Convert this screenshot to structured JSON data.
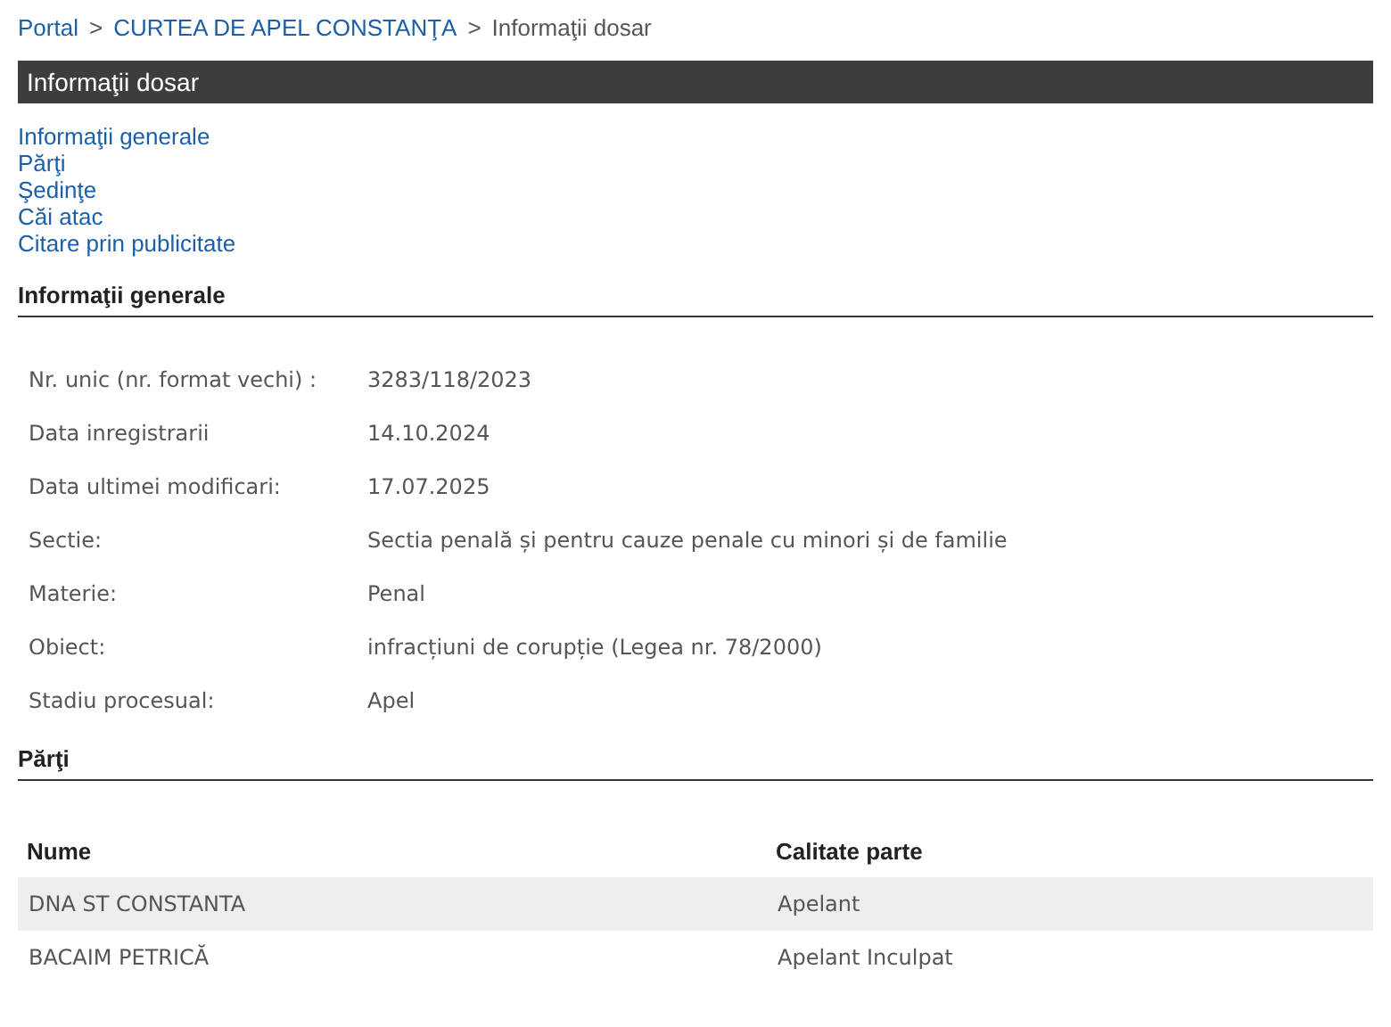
{
  "breadcrumb": [
    {
      "label": "Portal",
      "link": true
    },
    {
      "label": "CURTEA DE APEL CONSTANŢA",
      "link": true
    },
    {
      "label": "Informaţii dosar",
      "link": false
    }
  ],
  "separator": ">",
  "header_bar": {
    "title": "Informaţii dosar"
  },
  "nav_links": [
    "Informaţii generale",
    "Părţi",
    "Şedinţe",
    "Căi atac",
    "Citare prin publicitate"
  ],
  "general_info": {
    "title": "Informaţii generale",
    "fields": [
      {
        "label": "Nr. unic (nr. format vechi) :",
        "value": "3283/118/2023"
      },
      {
        "label": "Data inregistrarii",
        "value": "14.10.2024"
      },
      {
        "label": "Data ultimei modificari:",
        "value": "17.07.2025"
      },
      {
        "label": "Sectie:",
        "value": "Sectia penală și pentru cauze penale cu minori și de familie"
      },
      {
        "label": "Materie:",
        "value": "Penal"
      },
      {
        "label": "Obiect:",
        "value": "infracțiuni de corupție (Legea nr. 78/2000)"
      },
      {
        "label": "Stadiu procesual:",
        "value": "Apel"
      }
    ]
  },
  "parties": {
    "title": "Părţi",
    "columns": [
      "Nume",
      "Calitate parte"
    ],
    "rows": [
      [
        "DNA ST CONSTANTA",
        "Apelant"
      ],
      [
        "BACAIM PETRICĂ",
        "Apelant Inculpat"
      ]
    ]
  }
}
